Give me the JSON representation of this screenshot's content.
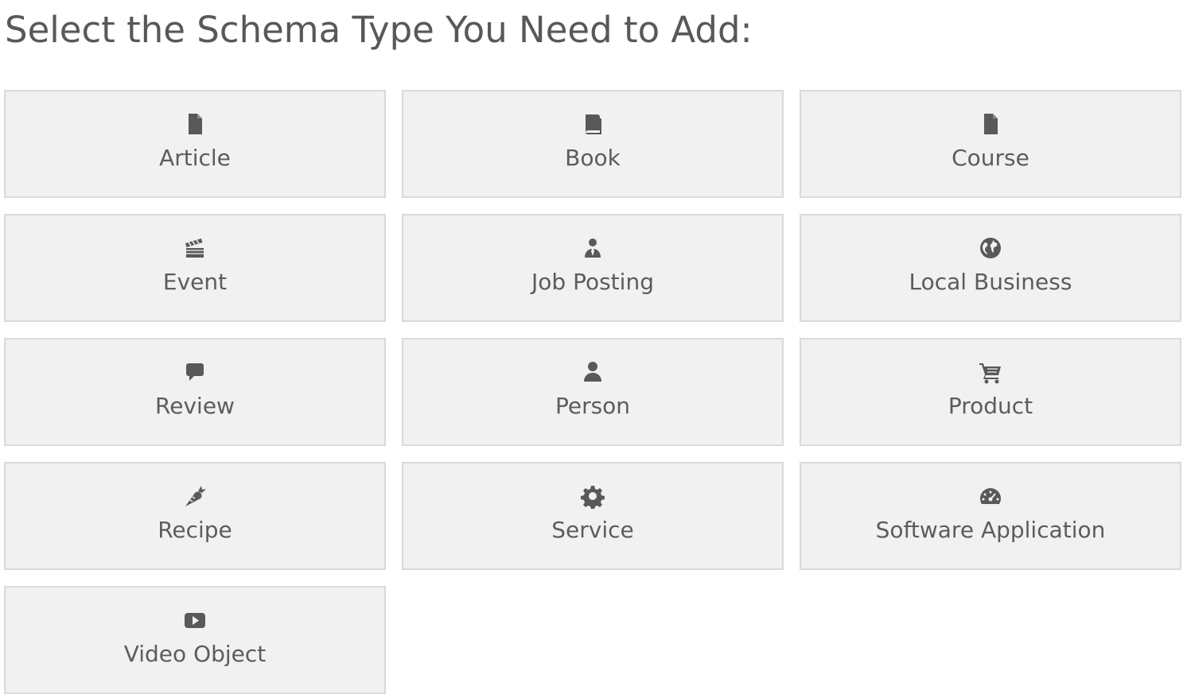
{
  "header": {
    "title": "Select the Schema Type You Need to Add:"
  },
  "schema_types": [
    {
      "label": "Article",
      "icon": "document-icon"
    },
    {
      "label": "Book",
      "icon": "book-icon"
    },
    {
      "label": "Course",
      "icon": "document-icon"
    },
    {
      "label": "Event",
      "icon": "clapperboard-icon"
    },
    {
      "label": "Job Posting",
      "icon": "user-tie-icon"
    },
    {
      "label": "Local Business",
      "icon": "globe-icon"
    },
    {
      "label": "Review",
      "icon": "speech-bubble-icon"
    },
    {
      "label": "Person",
      "icon": "person-icon"
    },
    {
      "label": "Product",
      "icon": "cart-icon"
    },
    {
      "label": "Recipe",
      "icon": "carrot-icon"
    },
    {
      "label": "Service",
      "icon": "gear-icon"
    },
    {
      "label": "Software Application",
      "icon": "dashboard-icon"
    },
    {
      "label": "Video Object",
      "icon": "video-play-icon"
    }
  ],
  "colors": {
    "tile_background": "#f1f1f1",
    "tile_border": "#dadada",
    "icon": "#595959",
    "text": "#5c5c5c"
  }
}
